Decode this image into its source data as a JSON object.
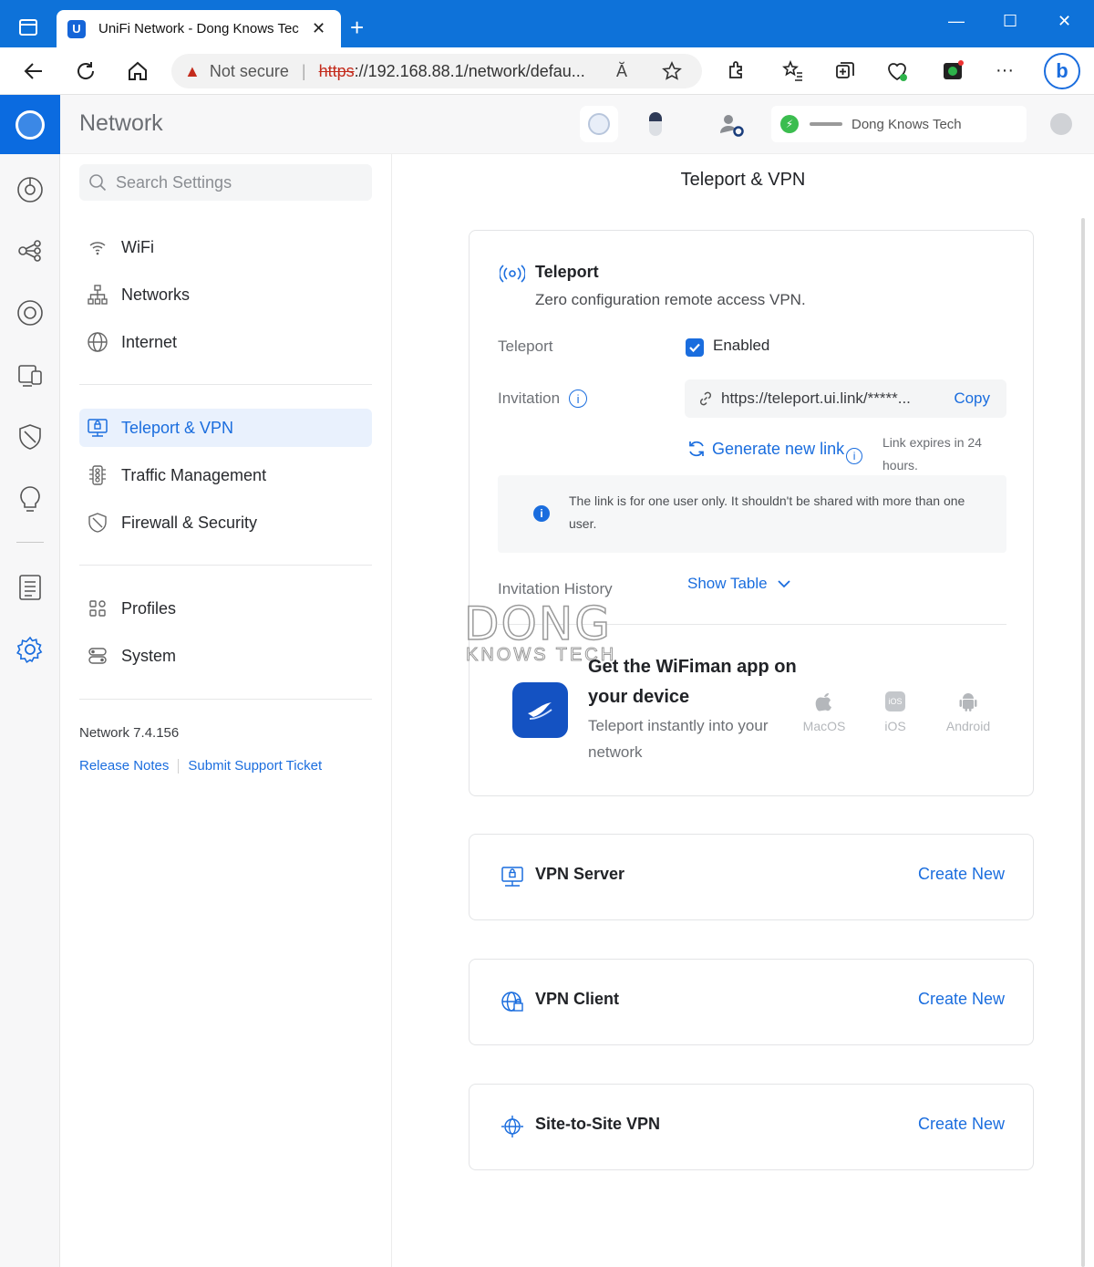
{
  "browser": {
    "tab_title": "UniFi Network - Dong Knows Tec",
    "tab_favicon": "U",
    "new_tab": "+",
    "minimize": "—",
    "maximize": "☐",
    "close": "✕",
    "not_secure": "Not secure",
    "url_scheme": "https",
    "url_rest": "://192.168.88.1/network/defau...",
    "read_aloud": "Ă",
    "more": "···"
  },
  "app": {
    "name": "Network",
    "site_name": "Dong Knows Tech"
  },
  "search": {
    "placeholder": "Search Settings"
  },
  "sidebar": {
    "items": [
      {
        "label": "WiFi",
        "icon": "wifi-icon"
      },
      {
        "label": "Networks",
        "icon": "network-topology-icon"
      },
      {
        "label": "Internet",
        "icon": "globe-icon"
      },
      {
        "label": "Teleport & VPN",
        "icon": "vpn-monitor-icon",
        "active": true
      },
      {
        "label": "Traffic Management",
        "icon": "traffic-light-icon"
      },
      {
        "label": "Firewall & Security",
        "icon": "shield-icon"
      },
      {
        "label": "Profiles",
        "icon": "profiles-grid-icon"
      },
      {
        "label": "System",
        "icon": "system-toggle-icon"
      }
    ],
    "version": "Network 7.4.156",
    "release_notes": "Release Notes",
    "support_ticket": "Submit Support Ticket"
  },
  "page": {
    "title": "Teleport & VPN"
  },
  "teleport": {
    "title": "Teleport",
    "subtitle": "Zero configuration remote access VPN.",
    "toggle_label": "Teleport",
    "enabled_label": "Enabled",
    "enabled": true,
    "invitation_label": "Invitation",
    "invitation_link": "https://teleport.ui.link/*****...",
    "copy": "Copy",
    "generate": "Generate new link",
    "expires": "Link expires in 24 hours.",
    "notice": "The link is for one user only. It shouldn't be shared with more than one user.",
    "history_label": "Invitation History",
    "show_table": "Show Table",
    "watermark_top": "DONG",
    "watermark_bottom": "KNOWS TECH"
  },
  "wifiman": {
    "title": "Get the WiFiman app on your device",
    "subtitle": "Teleport instantly into your network",
    "platforms": [
      {
        "label": "MacOS",
        "icon": "apple-icon"
      },
      {
        "label": "iOS",
        "icon": "ios-icon"
      },
      {
        "label": "Android",
        "icon": "android-icon"
      }
    ]
  },
  "vpn_sections": [
    {
      "title": "VPN Server",
      "action": "Create New",
      "icon": "vpn-server-icon"
    },
    {
      "title": "VPN Client",
      "action": "Create New",
      "icon": "vpn-client-globe-icon"
    },
    {
      "title": "Site-to-Site VPN",
      "action": "Create New",
      "icon": "site-to-site-icon"
    }
  ],
  "colors": {
    "accent": "#1a6dde",
    "browser_chrome": "#0e72d9",
    "warning": "#c42b1c",
    "online": "#3bbd4f"
  }
}
